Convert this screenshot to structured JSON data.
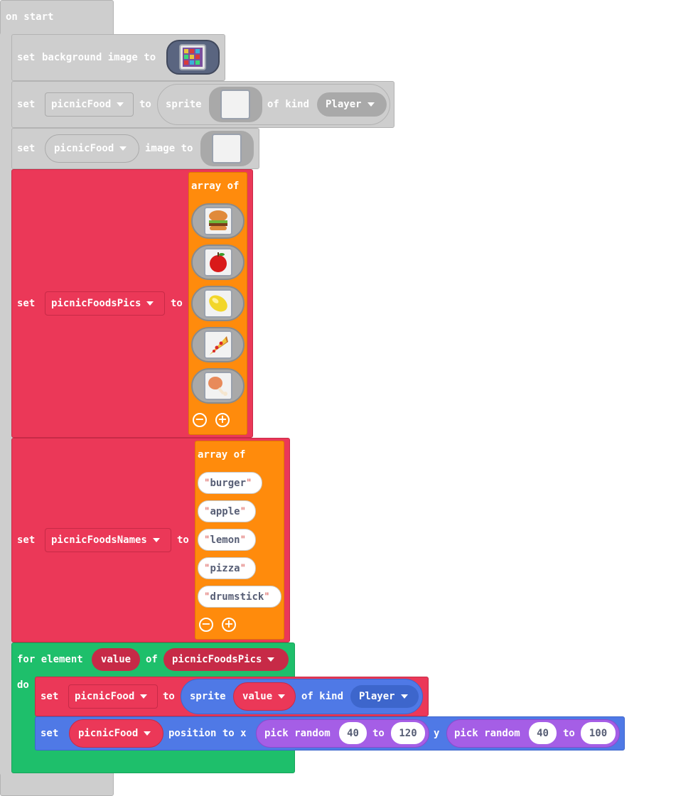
{
  "on_start": {
    "label": "on start"
  },
  "background": {
    "set": "set",
    "label": "background image to",
    "image": "tiled-pattern-icon"
  },
  "sprite_set": {
    "set": "set",
    "variable": "picnicFood",
    "to": "to",
    "sprite": "sprite",
    "of_kind": "of kind",
    "kind": "Player"
  },
  "image_set": {
    "set": "set",
    "variable": "picnicFood",
    "label": "image to"
  },
  "pics_array": {
    "set": "set",
    "variable": "picnicFoodsPics",
    "to": "to",
    "array_of": "array of",
    "items": [
      "burger-icon",
      "apple-icon",
      "lemon-icon",
      "pizza-icon",
      "drumstick-icon"
    ],
    "minus": "−",
    "plus": "+"
  },
  "names_array": {
    "set": "set",
    "variable": "picnicFoodsNames",
    "to": "to",
    "array_of": "array of",
    "items": [
      "burger",
      "apple",
      "lemon",
      "pizza",
      "drumstick"
    ],
    "quote": "\"",
    "minus": "−",
    "plus": "+"
  },
  "for_loop": {
    "for_element": "for element",
    "var": "value",
    "of": "of",
    "array": "picnicFoodsPics",
    "do": "do",
    "set1": {
      "set": "set",
      "variable": "picnicFood",
      "to": "to",
      "sprite": "sprite",
      "value": "value",
      "of_kind": "of kind",
      "kind": "Player"
    },
    "set2": {
      "set": "set",
      "variable": "picnicFood",
      "position": "position to x",
      "pick_random": "pick random",
      "x_min": "40",
      "to": "to",
      "x_max": "120",
      "y": "y",
      "y_min": "40",
      "y_max": "100"
    }
  },
  "colors": {
    "gray": "#cecece",
    "red": "#eb3858",
    "orange": "#ff8b0c",
    "green": "#1ebf6b",
    "blue": "#4f79e6",
    "purple": "#a55ee6"
  }
}
